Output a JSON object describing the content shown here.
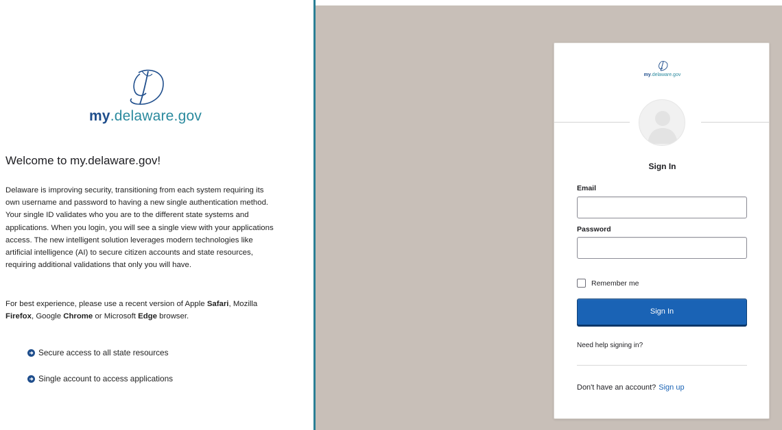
{
  "left": {
    "logo": {
      "brand_prefix": "my",
      "brand_suffix": ".delaware.gov",
      "monogram": "D"
    },
    "welcome_heading": "Welcome to my.delaware.gov!",
    "intro": "Delaware is improving security, transitioning from each system requiring its own username and password to having a new single authentication method. Your single ID validates who you are to the different state systems and applications. When you login, you will see a single view with your applications access. The new intelligent solution leverages modern technologies like artificial intelligence (AI) to secure citizen accounts and state resources, requiring additional validations that only you will have.",
    "browsers": {
      "text1": "For best experience, please use a recent version of Apple ",
      "safari": "Safari",
      "text2": ", Mozilla ",
      "firefox": "Firefox",
      "text3": ", Google ",
      "chrome": "Chrome",
      "text4": " or Microsoft ",
      "edge": "Edge",
      "text5": " browser."
    },
    "features": [
      {
        "icon": "arrow-circle-right-icon",
        "label": "Secure access to all state resources"
      },
      {
        "icon": "arrow-circle-right-icon",
        "label": "Single account to access applications"
      }
    ]
  },
  "card": {
    "logo": {
      "brand_prefix": "my",
      "brand_suffix": ".delaware.gov"
    },
    "avatar_icon": "user-avatar-icon",
    "title": "Sign In",
    "email": {
      "label": "Email",
      "value": "",
      "placeholder": ""
    },
    "password": {
      "label": "Password",
      "value": "",
      "placeholder": ""
    },
    "remember_label": "Remember me",
    "remember_checked": false,
    "signin_button": "Sign In",
    "help_link": "Need help signing in?",
    "signup_prompt": "Don't have an account?",
    "signup_link": "Sign up"
  },
  "colors": {
    "brand_blue": "#1f4e8c",
    "brand_teal": "#2a8a9e",
    "divider": "#2a7f95",
    "right_background": "#c8bfb8",
    "button_blue": "#1a63b5"
  }
}
